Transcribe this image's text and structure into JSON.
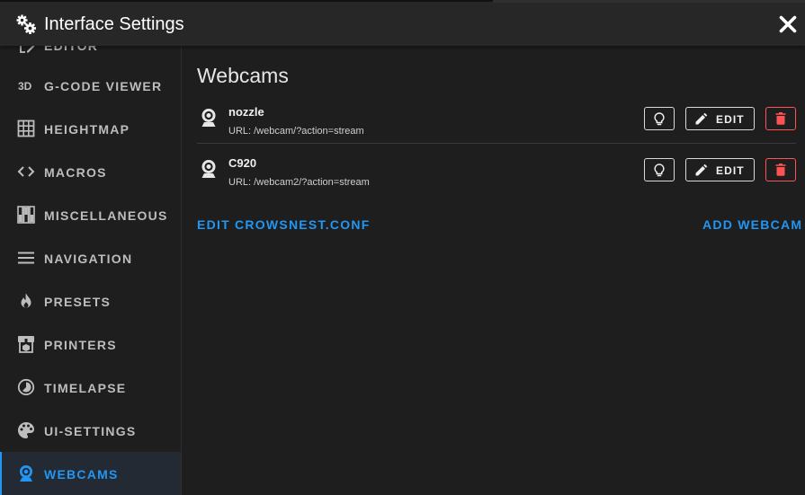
{
  "dialog": {
    "title": "Interface Settings"
  },
  "sidebar": {
    "items": [
      {
        "label": "EDITOR",
        "icon": "file-edit-icon",
        "active": false
      },
      {
        "label": "G-CODE VIEWER",
        "icon": "3d-icon",
        "active": false
      },
      {
        "label": "HEIGHTMAP",
        "icon": "grid-icon",
        "active": false
      },
      {
        "label": "MACROS",
        "icon": "code-brackets-icon",
        "active": false
      },
      {
        "label": "MISCELLANEOUS",
        "icon": "dip-switch-icon",
        "active": false
      },
      {
        "label": "NAVIGATION",
        "icon": "menu-icon",
        "active": false
      },
      {
        "label": "PRESETS",
        "icon": "fire-icon",
        "active": false
      },
      {
        "label": "PRINTERS",
        "icon": "printer-3d-icon",
        "active": false
      },
      {
        "label": "TIMELAPSE",
        "icon": "timelapse-icon",
        "active": false
      },
      {
        "label": "UI-SETTINGS",
        "icon": "palette-icon",
        "active": false
      },
      {
        "label": "WEBCAMS",
        "icon": "webcam-icon",
        "active": true
      }
    ]
  },
  "main": {
    "title": "Webcams",
    "webcams": [
      {
        "name": "nozzle",
        "url": "URL: /webcam/?action=stream"
      },
      {
        "name": "C920",
        "url": "URL: /webcam2/?action=stream"
      }
    ],
    "edit_label": "EDIT",
    "edit_conf_label": "EDIT CROWSNEST.CONF",
    "add_webcam_label": "ADD WEBCAM"
  },
  "colors": {
    "accent": "#2196f3",
    "danger": "#ff5252",
    "background": "#1e1e1e",
    "titlebar": "#272727"
  }
}
